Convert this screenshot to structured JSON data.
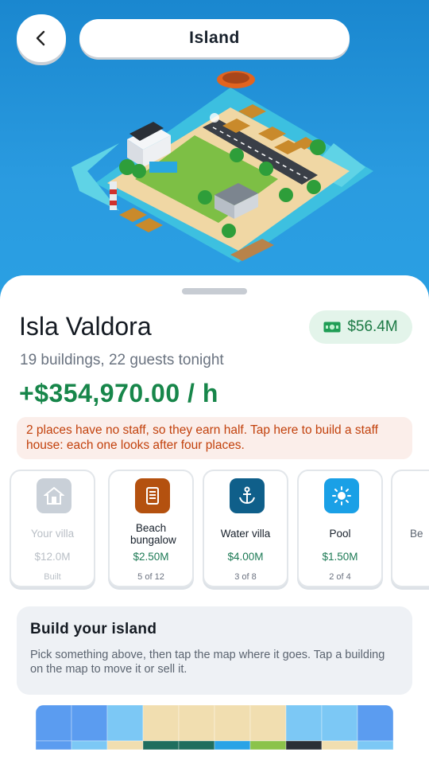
{
  "header": {
    "title": "Island"
  },
  "island": {
    "name": "Isla Valdora",
    "cash": "$56.4M",
    "summary": "19 buildings, 22 guests tonight",
    "income": "+$354,970.00 / h",
    "warning": "2 places have no staff, so they earn half. Tap here to build a staff house: each one looks after four places."
  },
  "buildings": [
    {
      "name": "Your villa",
      "price": "$12.0M",
      "count": "Built",
      "icon": "house-icon",
      "color": "#c9d0d8"
    },
    {
      "name": "Beach bungalow",
      "price": "$2.50M",
      "count": "5 of 12",
      "icon": "bungalow-icon",
      "color": "#b4510f"
    },
    {
      "name": "Water villa",
      "price": "$4.00M",
      "count": "3 of 8",
      "icon": "anchor-icon",
      "color": "#0f5f8a"
    },
    {
      "name": "Pool",
      "price": "$1.50M",
      "count": "2 of 4",
      "icon": "sun-icon",
      "color": "#1aa0e6"
    },
    {
      "name": "Be",
      "price": "",
      "count": "",
      "icon": "",
      "color": "#ffffff"
    }
  ],
  "build_panel": {
    "title": "Build your island",
    "text": "Pick something above, then tap the map where it goes. Tap a building on the map to move it or sell it."
  },
  "colors": {
    "accent_green": "#17864a",
    "warning_text": "#c2410c",
    "sea": "#1f8fd6"
  }
}
